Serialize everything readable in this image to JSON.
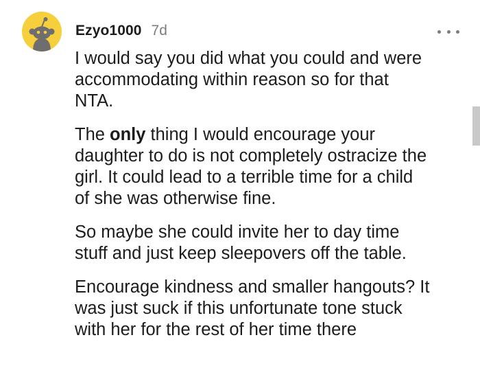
{
  "comment": {
    "avatar": "snoo-avatar-icon",
    "username": "Ezyo1000",
    "timestamp": "7d",
    "more_icon": "more-horizontal-icon",
    "paragraphs": [
      {
        "lines": [
          "I would say you did what you could and were",
          "accommodating within reason so for that",
          "NTA."
        ]
      },
      {
        "prefix": "The ",
        "bold": "only",
        "suffix_lines": [
          " thing I would encourage your",
          "daughter to do is not completely ostracize the",
          "girl. It could lead to a terrible time for a child",
          "of she was otherwise fine."
        ]
      },
      {
        "lines": [
          "So maybe she could invite her to day time",
          "stuff and just keep sleepovers off the table."
        ]
      },
      {
        "lines": [
          "Encourage kindness and smaller hangouts? It",
          "was just suck if this unfortunate tone stuck",
          "with her for the rest of her time there"
        ]
      }
    ]
  },
  "colors": {
    "avatar_bg": "#f5cf3c",
    "text": "#1c1c1c",
    "meta": "#7c7c7c",
    "scrollbar": "#c9c9c9"
  }
}
